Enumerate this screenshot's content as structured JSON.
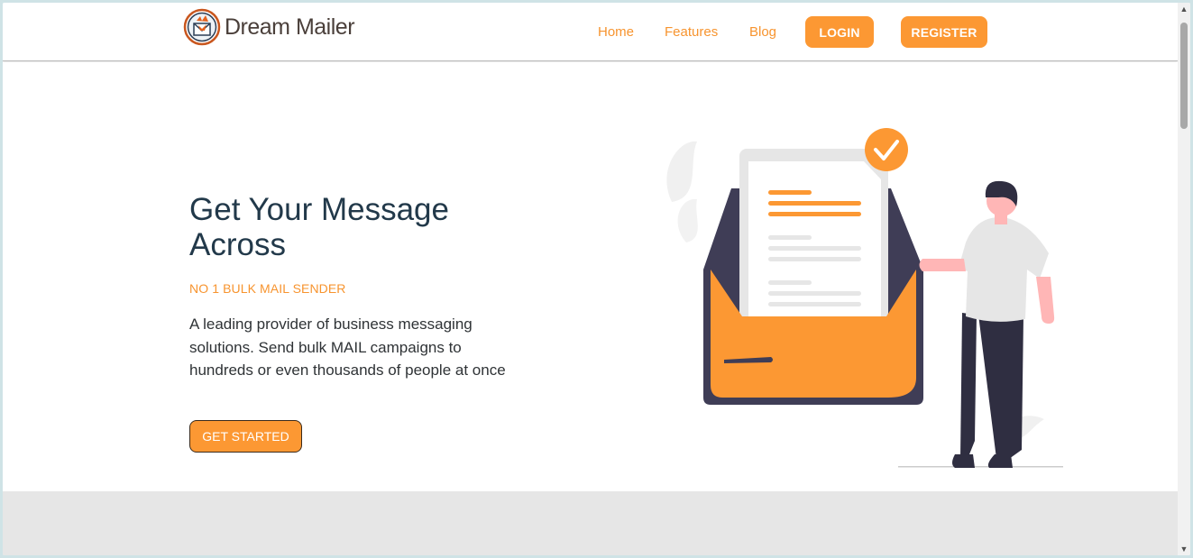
{
  "brand": {
    "name": "Dream Mailer",
    "logo_icon": "envelope-fox-logo-icon"
  },
  "nav": {
    "links": [
      "Home",
      "Features",
      "Blog"
    ],
    "login_label": "LOGIN",
    "register_label": "REGISTER"
  },
  "hero": {
    "title": "Get Your Message Across",
    "subtitle": "NO 1 BULK MAIL SENDER",
    "description": "A leading provider of business messaging solutions. Send bulk MAIL campaigns to hundreds or even thousands of people at once",
    "cta_label": "GET STARTED",
    "illustration": "person-with-envelope-illustration"
  },
  "colors": {
    "accent": "#fc9833",
    "heading": "#22394a",
    "envelope_dark": "#3f3d56",
    "band": "#e6e6e6"
  }
}
